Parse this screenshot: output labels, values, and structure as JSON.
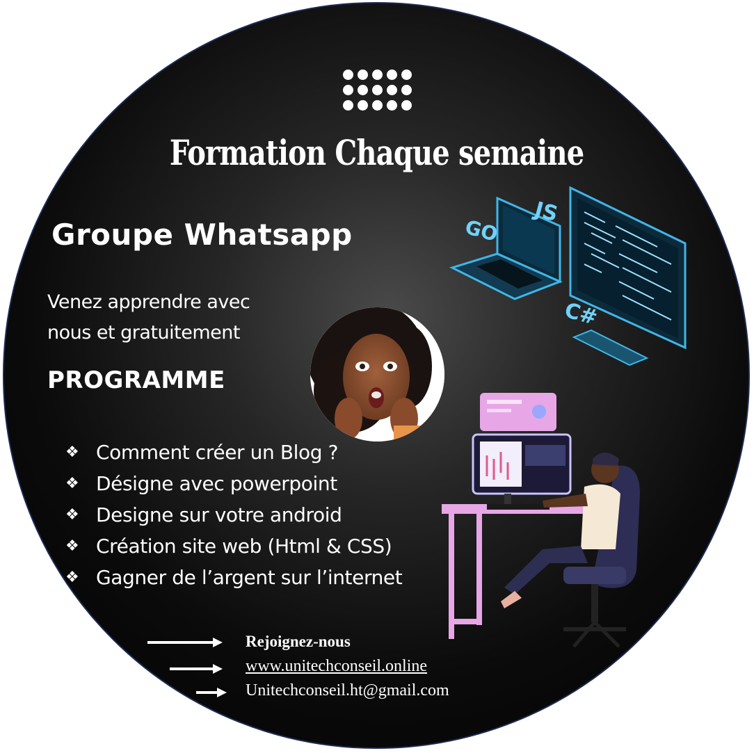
{
  "title": "Formation Chaque semaine",
  "subtitle": "Groupe Whatsapp",
  "intro": {
    "line1": "Venez apprendre avec",
    "line2": "nous et gratuitement"
  },
  "program_heading": "PROGRAMME",
  "program_items": [
    "Comment créer un Blog ?",
    "Désigne avec powerpoint",
    "Designe sur votre android",
    "Création site web (Html & CSS)",
    "Gagner de l’argent sur l’internet"
  ],
  "bullet_icon": "diamond-bullet-icon",
  "footer": {
    "join": "Rejoignez-nous",
    "website": "www.unitechconseil.online",
    "email": "Unitechconseil.ht@gmail.com"
  },
  "illustration_labels": {
    "go": "GO",
    "js": "JS",
    "csharp": "C#"
  },
  "colors": {
    "background": "#000000",
    "text": "#ffffff",
    "neon": "#3fb6e8",
    "pink_desk": "#e7a6e6",
    "border": "#1e2a55"
  }
}
